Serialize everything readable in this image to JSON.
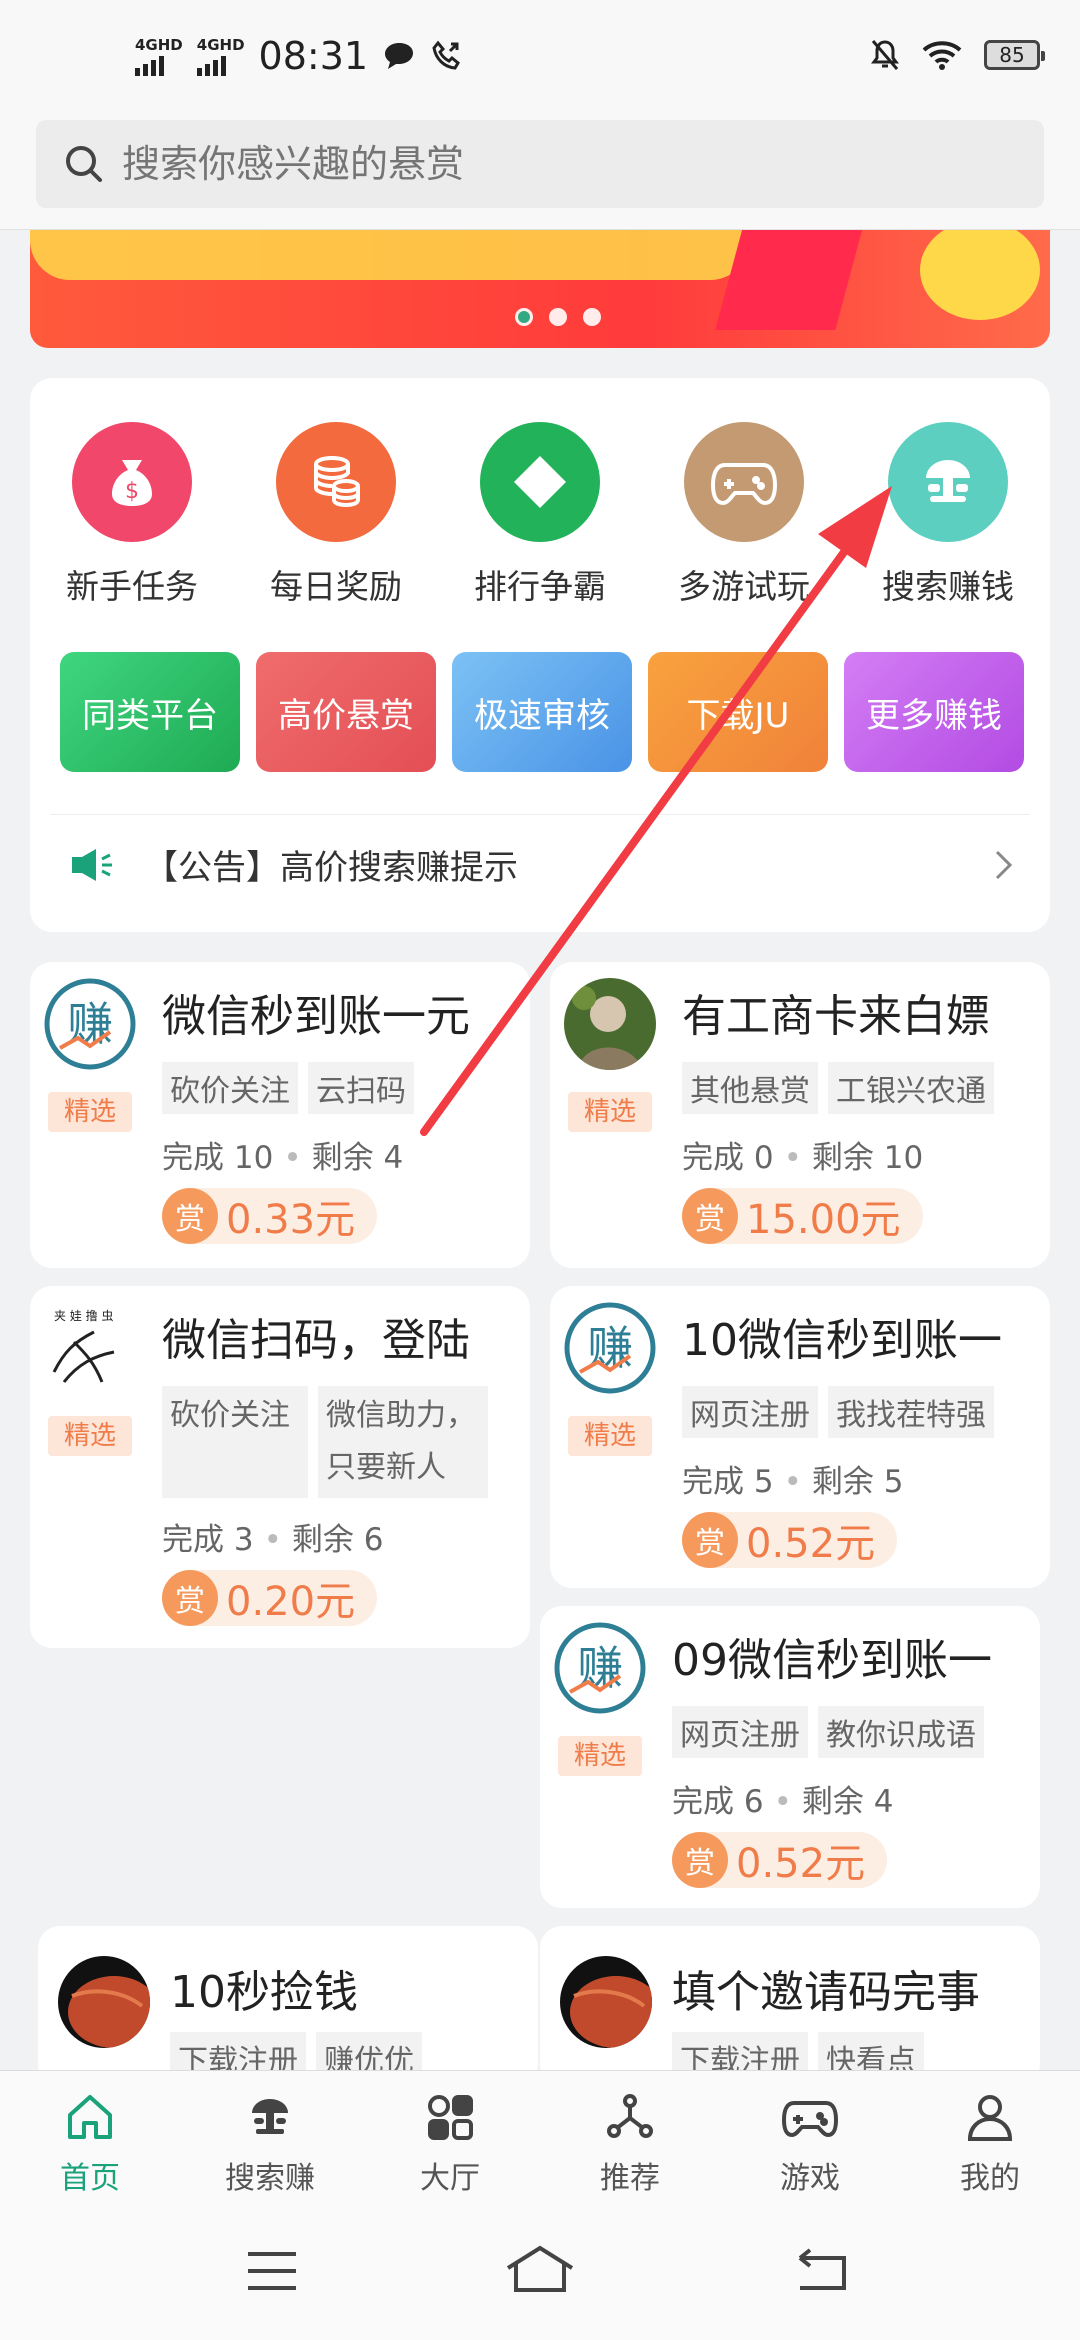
{
  "status_bar": {
    "net1": "4GHD",
    "net2": "4GHD",
    "time": "08:31",
    "battery": "85"
  },
  "search": {
    "placeholder": "搜索你感兴趣的悬赏"
  },
  "menu": {
    "icons": [
      {
        "label": "新手任务",
        "color": "#f0476a"
      },
      {
        "label": "每日奖励",
        "color": "#f26a3d"
      },
      {
        "label": "排行争霸",
        "color": "#22b35a"
      },
      {
        "label": "多游试玩",
        "color": "#c49a72"
      },
      {
        "label": "搜索赚钱",
        "color": "#5ccfc0"
      }
    ],
    "tiles": [
      "同类平台",
      "高价悬赏",
      "极速审核",
      "下载JU",
      "更多赚钱"
    ],
    "notice": "【公告】高价搜索赚提示"
  },
  "tasks": [
    {
      "title": "微信秒到账一元",
      "badge": "精选",
      "tags": [
        "砍价关注",
        "云扫码"
      ],
      "done": "完成 10",
      "left": "剩余 4",
      "reward_icon": "赏",
      "reward": "0.33元"
    },
    {
      "title": "有工商卡来白嫖",
      "badge": "精选",
      "tags": [
        "其他悬赏",
        "工银兴农通"
      ],
      "done": "完成 0",
      "left": "剩余 10",
      "reward_icon": "赏",
      "reward": "15.00元"
    },
    {
      "title": "微信扫码，登陆",
      "badge": "精选",
      "tags": [
        "砍价关注",
        "微信助力，",
        "只要新人"
      ],
      "done": "完成 3",
      "left": "剩余 6",
      "reward_icon": "赏",
      "reward": "0.20元"
    },
    {
      "title": "10微信秒到账一",
      "badge": "精选",
      "tags": [
        "网页注册",
        "我找茬特强"
      ],
      "done": "完成 5",
      "left": "剩余 5",
      "reward_icon": "赏",
      "reward": "0.52元"
    },
    {
      "title": "09微信秒到账一",
      "badge": "精选",
      "tags": [
        "网页注册",
        "教你识成语"
      ],
      "done": "完成 6",
      "left": "剩余 4",
      "reward_icon": "赏",
      "reward": "0.52元"
    },
    {
      "title": "10秒捡钱",
      "tags": [
        "下载注册",
        "赚优优"
      ]
    },
    {
      "title": "填个邀请码完事",
      "tags": [
        "下载注册",
        "快看点"
      ]
    }
  ],
  "tabs": [
    "首页",
    "搜索赚",
    "大厅",
    "推荐",
    "游戏",
    "我的"
  ],
  "colors": {
    "accent": "#1aa27b",
    "reward": "#f07c4a",
    "arrow": "#f23c44"
  }
}
